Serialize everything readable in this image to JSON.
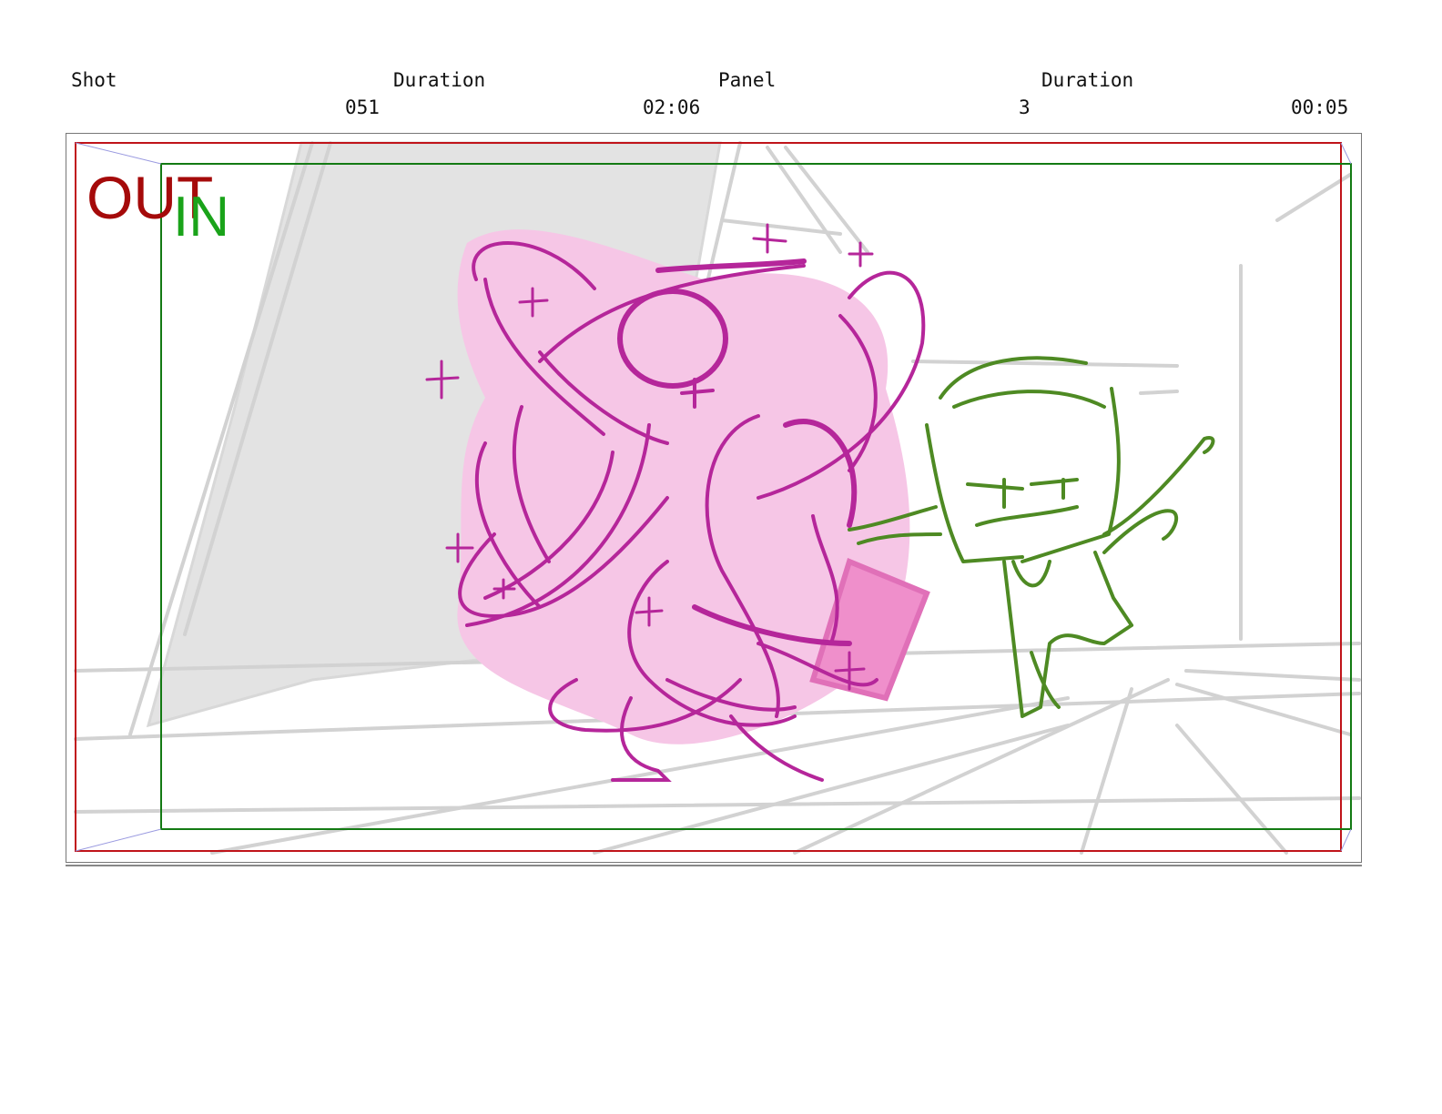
{
  "header": {
    "shot_label": "Shot",
    "shot_value": "051",
    "shot_duration_label": "Duration",
    "shot_duration_value": "02:06",
    "panel_label": "Panel",
    "panel_value": "3",
    "panel_duration_label": "Duration",
    "panel_duration_value": "00:05"
  },
  "frame": {
    "out_label": "OUT",
    "in_label": "IN",
    "colors": {
      "out_frame": "#c0141a",
      "in_frame": "#137a13",
      "out_text": "#a50a0a",
      "in_text": "#1aa31a",
      "sketch_magenta": "#b5269a",
      "sketch_pink_fill": "#f6c6e6",
      "sketch_green": "#4e8a23",
      "background_lines": "#d2d2d2"
    },
    "subjects": [
      "magenta-tentacle-creature-sketch",
      "green-running-character-sketch"
    ]
  }
}
